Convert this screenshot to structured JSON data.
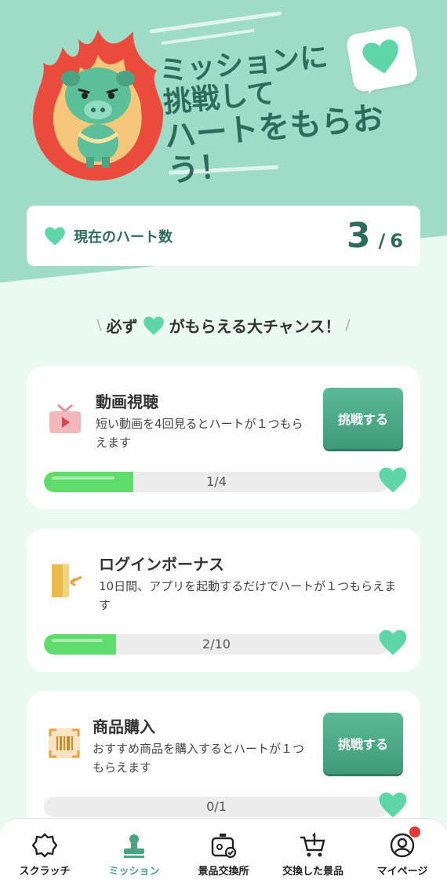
{
  "hero": {
    "title_line1": "ミッションに",
    "title_line2": "挑戦して",
    "title_line3": "ハートをもらおう！"
  },
  "heart_count": {
    "label": "現在のハート数",
    "current": "3",
    "separator": "/",
    "total": "6"
  },
  "chance_banner": {
    "left_deco": "\\",
    "text_before": "必ず",
    "text_after": "がもらえる大チャンス！",
    "right_deco": "/"
  },
  "missions": [
    {
      "title": "動画視聴",
      "description": "短い動画を4回見るとハートが１つもらえます",
      "button_label": "挑戦する",
      "progress_text": "1/4",
      "progress": 0.25,
      "icon": "tv-icon"
    },
    {
      "title": "ログインボーナス",
      "description": "10日間、アプリを起動するだけでハートが１つもらえます",
      "progress_text": "2/10",
      "progress": 0.2,
      "icon": "door-icon"
    },
    {
      "title": "商品購入",
      "description": "おすすめ商品を購入するとハートが１つもらえます",
      "button_label": "挑戦する",
      "progress_text": "0/1",
      "progress": 0,
      "icon": "barcode-icon"
    }
  ],
  "nav": [
    {
      "label": "スクラッチ",
      "icon": "scratch-icon",
      "active": false
    },
    {
      "label": "ミッション",
      "icon": "mission-stamp-icon",
      "active": true
    },
    {
      "label": "景品交換所",
      "icon": "exchange-icon",
      "active": false
    },
    {
      "label": "交換した景品",
      "icon": "cart-icon",
      "active": false
    },
    {
      "label": "マイページ",
      "icon": "user-icon",
      "active": false
    }
  ],
  "colors": {
    "accent": "#4aa383",
    "hero_bg": "#9fdcc8",
    "page_bg": "#eafaf3",
    "heart": "#5ed6a8",
    "progress_fill": "#5fdc6b",
    "badge": "#e53935"
  }
}
